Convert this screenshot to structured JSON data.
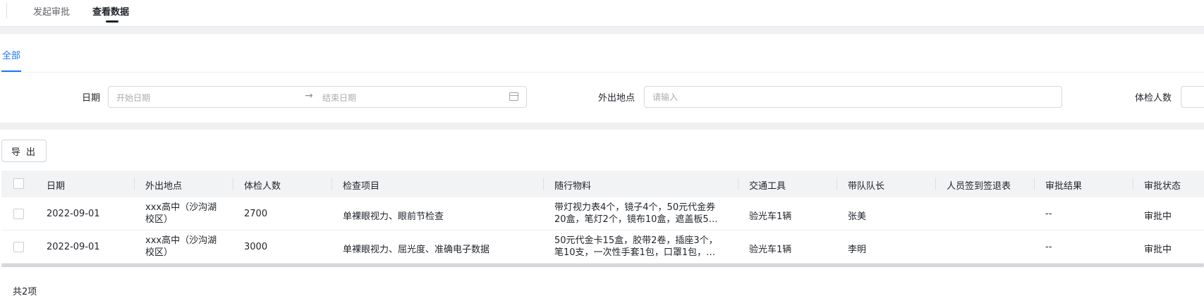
{
  "topnav": {
    "tabs": [
      {
        "label": "发起审批",
        "active": false
      },
      {
        "label": "查看数据",
        "active": true
      }
    ]
  },
  "filter": {
    "subtab": "全部",
    "date_label": "日期",
    "start_placeholder": "开始日期",
    "end_placeholder": "结束日期",
    "range_arrow": "→",
    "location_label": "外出地点",
    "location_placeholder": "请输入",
    "count_label": "体检人数"
  },
  "toolbar": {
    "export_label": "导 出"
  },
  "table": {
    "columns": [
      "日期",
      "外出地点",
      "体检人数",
      "检查项目",
      "随行物料",
      "交通工具",
      "带队队长",
      "人员签到签退表",
      "审批结果",
      "审批状态"
    ],
    "rows": [
      {
        "date": "2022-09-01",
        "location": "xxx高中（沙沟湖校区）",
        "count": "2700",
        "items": "单裸眼视力、眼前节检查",
        "materials": "带灯视力表4个，镜子4个，50元代金券20盒，笔灯2个，镜布10盒，遮盖板5…",
        "transport": "验光车1辆",
        "leader": "张美",
        "signin": "",
        "result": "--",
        "status": "审批中"
      },
      {
        "date": "2022-09-01",
        "location": "xxx高中（沙沟湖校区）",
        "count": "3000",
        "items": "单裸眼视力、屈光度、准确电子数据",
        "materials": "50元代金卡15盒，胶带2卷，插座3个，笔10支，一次性手套1包，口罩1包，…",
        "transport": "验光车1辆",
        "leader": "李明",
        "signin": "",
        "result": "--",
        "status": "审批中"
      }
    ]
  },
  "footer": {
    "total": "共2项"
  },
  "colors": {
    "accent": "#1677ff",
    "header_bg": "#f2f3f5",
    "page_bg": "#f0f1f3"
  }
}
